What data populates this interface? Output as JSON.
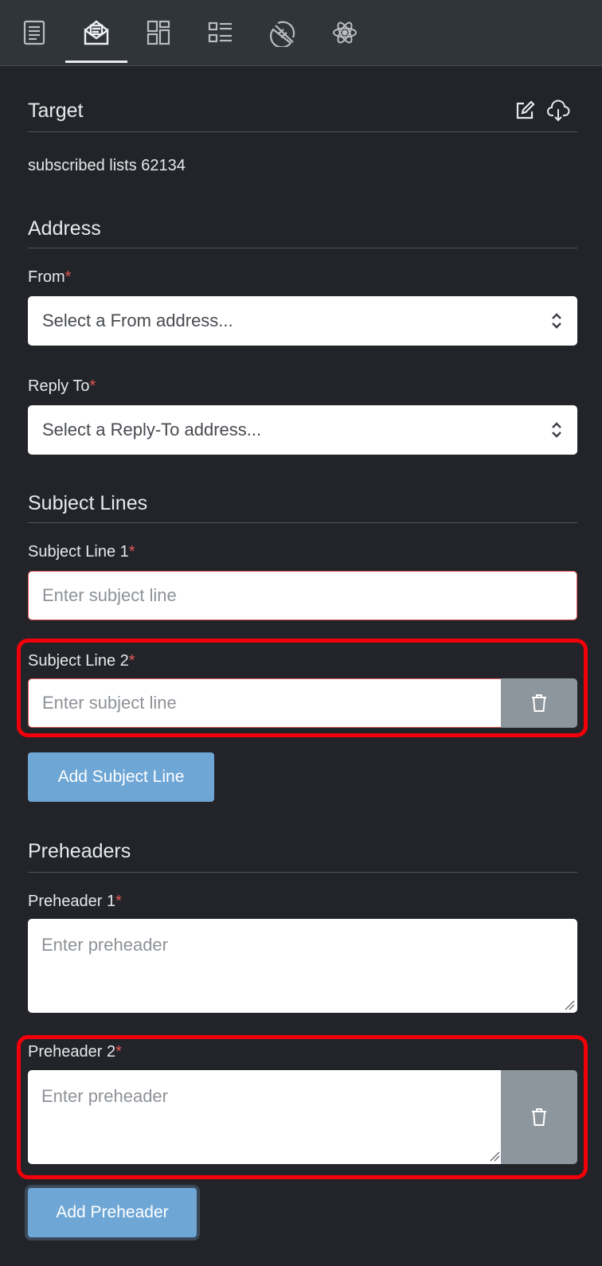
{
  "toolbar": {
    "tabs": [
      {
        "icon": "document-icon",
        "active": false
      },
      {
        "icon": "envelope-edit-icon",
        "active": true
      },
      {
        "icon": "layout-grid-icon",
        "active": false
      },
      {
        "icon": "list-icon",
        "active": false
      },
      {
        "icon": "segment-pie-icon",
        "active": false
      },
      {
        "icon": "atom-icon",
        "active": false
      }
    ]
  },
  "target": {
    "title": "Target",
    "edit_icon": "edit-icon",
    "download_icon": "cloud-download-icon",
    "summary": "subscribed lists 62134"
  },
  "address": {
    "title": "Address",
    "from_label": "From",
    "from_placeholder": "Select a From address...",
    "reply_label": "Reply To",
    "reply_placeholder": "Select a Reply-To address..."
  },
  "subject_lines": {
    "title": "Subject Lines",
    "items": [
      {
        "label": "Subject Line 1",
        "placeholder": "Enter subject line"
      },
      {
        "label": "Subject Line 2",
        "placeholder": "Enter subject line"
      }
    ],
    "add_label": "Add Subject Line"
  },
  "preheaders": {
    "title": "Preheaders",
    "items": [
      {
        "label": "Preheader 1",
        "placeholder": "Enter preheader"
      },
      {
        "label": "Preheader 2",
        "placeholder": "Enter preheader"
      }
    ],
    "add_label": "Add Preheader"
  },
  "required_marker": "*",
  "colors": {
    "background": "#222429",
    "toolbar": "#30343b",
    "required": "#e35555",
    "primary_button": "#6ea6d5",
    "trash_button": "#8d969d",
    "highlight": "#f2000a"
  }
}
